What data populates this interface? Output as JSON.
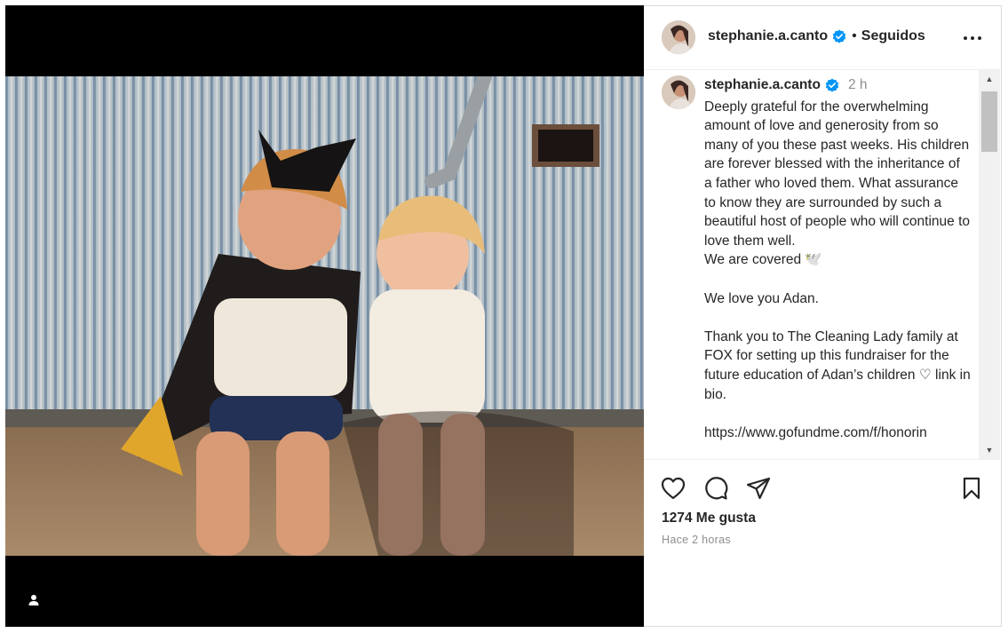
{
  "post": {
    "username": "stephanie.a.canto",
    "follow_status": "Seguidos",
    "separator": "•",
    "more_label": "Más opciones",
    "caption_time": "2 h",
    "caption_text": "Deeply grateful for the overwhelming amount of love and generosity from so many of you these past weeks. His children are forever blessed with the inheritance of a father who loved them. What assurance to know they are surrounded by such a beautiful host of people who will continue to love them well.\nWe are covered 🕊️\n\nWe love you Adan.\n\nThank you to The Cleaning Lady family at FOX for setting up this fundraiser for the future education of Adan’s children ♡ link in bio.\n\nhttps://www.gofundme.com/f/honorin",
    "likes_text": "1274 Me gusta",
    "posted_ago": "Hace 2 horas"
  },
  "icons": {
    "verified": "verified-badge-icon",
    "more": "more-options-icon",
    "like": "heart-icon",
    "comment": "comment-icon",
    "share": "share-icon",
    "save": "bookmark-icon",
    "tag": "user-tag-icon"
  },
  "colors": {
    "verified": "#0095f6",
    "text": "#262626",
    "muted": "#8e8e8e",
    "media_bg": "#000000"
  }
}
